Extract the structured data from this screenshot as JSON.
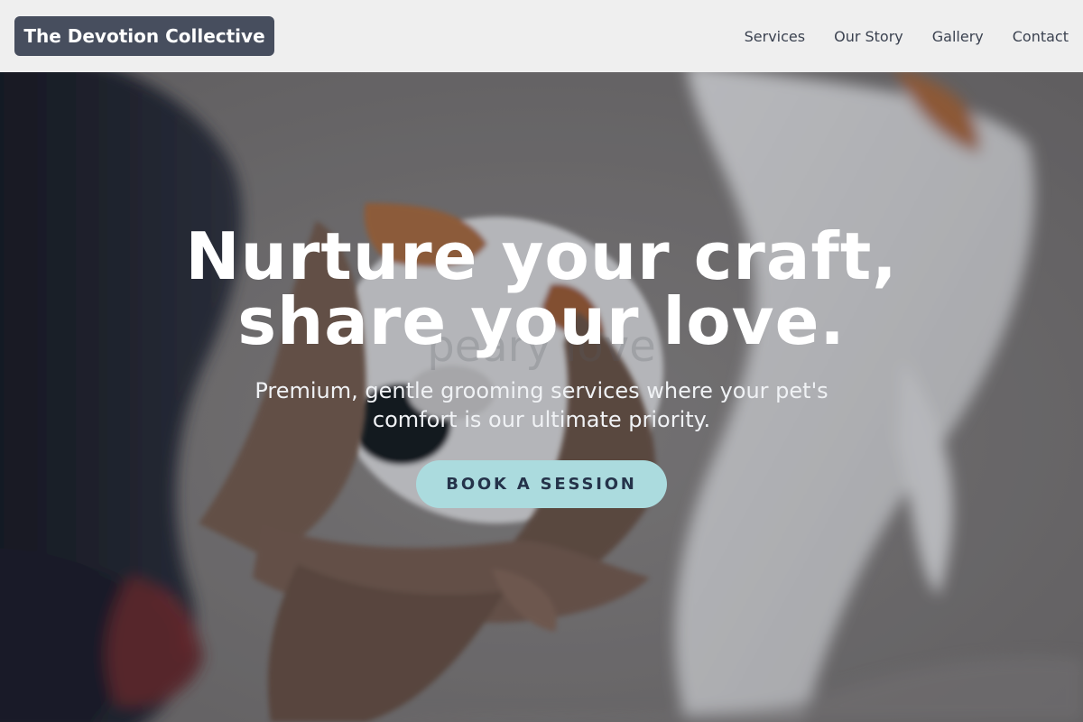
{
  "header": {
    "brand": "The Devotion Collective",
    "nav": [
      "Services",
      "Our Story",
      "Gallery",
      "Contact"
    ]
  },
  "hero": {
    "title_line1": "Nurture your craft,",
    "title_line2": "share your love.",
    "subtitle": "Premium, gentle grooming services where your pet's comfort is our ultimate priority.",
    "button": "BOOK A SESSION",
    "image_subject": "person-holding-dog-photo"
  },
  "colors": {
    "header_bg": "#efefef",
    "brand_bg": "#474e5e",
    "nav_text": "#3b4250",
    "button_bg": "#abdbde",
    "button_text": "#25334a"
  }
}
